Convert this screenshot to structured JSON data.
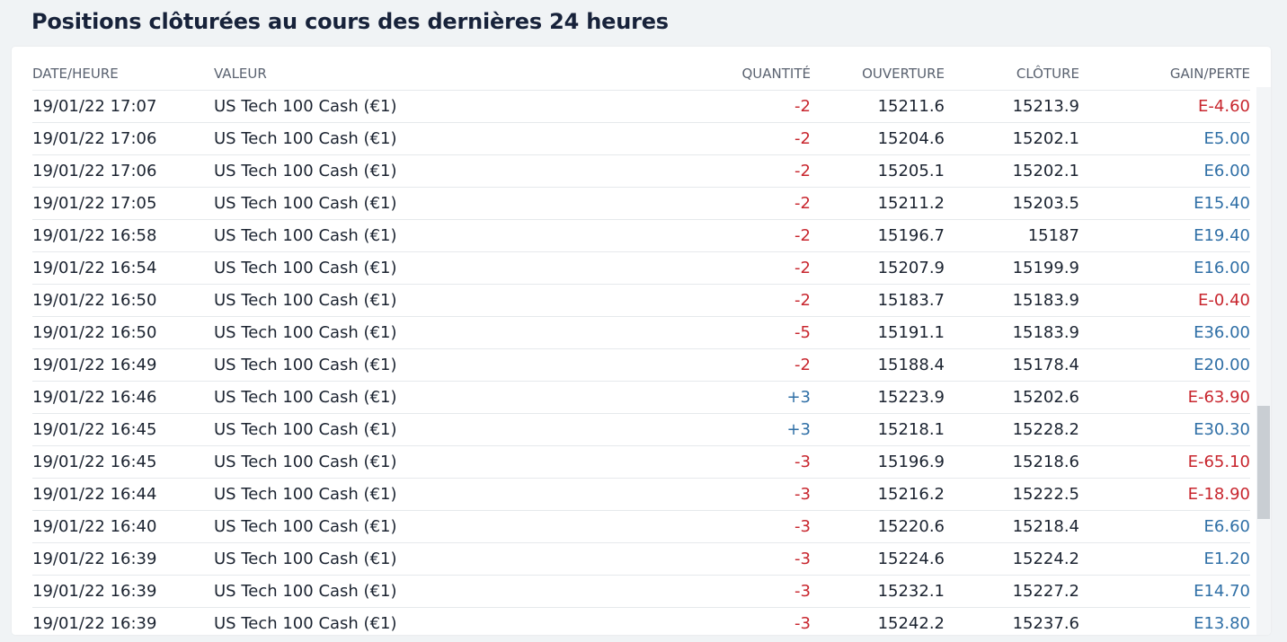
{
  "title": "Positions clôturées au cours des dernières 24 heures",
  "columns": {
    "date": "DATE/HEURE",
    "value": "VALEUR",
    "quantity": "QUANTITÉ",
    "open": "OUVERTURE",
    "close": "CLÔTURE",
    "pl": "GAIN/PERTE"
  },
  "colors": {
    "negative": "#c8262e",
    "positive": "#2f6fa6"
  },
  "rows": [
    {
      "date": "19/01/22 17:07",
      "value": "US Tech 100 Cash (€1)",
      "qty": "-2",
      "open": "15211.6",
      "close": "15213.9",
      "pl": "E-4.60"
    },
    {
      "date": "19/01/22 17:06",
      "value": "US Tech 100 Cash (€1)",
      "qty": "-2",
      "open": "15204.6",
      "close": "15202.1",
      "pl": "E5.00"
    },
    {
      "date": "19/01/22 17:06",
      "value": "US Tech 100 Cash (€1)",
      "qty": "-2",
      "open": "15205.1",
      "close": "15202.1",
      "pl": "E6.00"
    },
    {
      "date": "19/01/22 17:05",
      "value": "US Tech 100 Cash (€1)",
      "qty": "-2",
      "open": "15211.2",
      "close": "15203.5",
      "pl": "E15.40"
    },
    {
      "date": "19/01/22 16:58",
      "value": "US Tech 100 Cash (€1)",
      "qty": "-2",
      "open": "15196.7",
      "close": "15187",
      "pl": "E19.40"
    },
    {
      "date": "19/01/22 16:54",
      "value": "US Tech 100 Cash (€1)",
      "qty": "-2",
      "open": "15207.9",
      "close": "15199.9",
      "pl": "E16.00"
    },
    {
      "date": "19/01/22 16:50",
      "value": "US Tech 100 Cash (€1)",
      "qty": "-2",
      "open": "15183.7",
      "close": "15183.9",
      "pl": "E-0.40"
    },
    {
      "date": "19/01/22 16:50",
      "value": "US Tech 100 Cash (€1)",
      "qty": "-5",
      "open": "15191.1",
      "close": "15183.9",
      "pl": "E36.00"
    },
    {
      "date": "19/01/22 16:49",
      "value": "US Tech 100 Cash (€1)",
      "qty": "-2",
      "open": "15188.4",
      "close": "15178.4",
      "pl": "E20.00"
    },
    {
      "date": "19/01/22 16:46",
      "value": "US Tech 100 Cash (€1)",
      "qty": "+3",
      "open": "15223.9",
      "close": "15202.6",
      "pl": "E-63.90"
    },
    {
      "date": "19/01/22 16:45",
      "value": "US Tech 100 Cash (€1)",
      "qty": "+3",
      "open": "15218.1",
      "close": "15228.2",
      "pl": "E30.30"
    },
    {
      "date": "19/01/22 16:45",
      "value": "US Tech 100 Cash (€1)",
      "qty": "-3",
      "open": "15196.9",
      "close": "15218.6",
      "pl": "E-65.10"
    },
    {
      "date": "19/01/22 16:44",
      "value": "US Tech 100 Cash (€1)",
      "qty": "-3",
      "open": "15216.2",
      "close": "15222.5",
      "pl": "E-18.90"
    },
    {
      "date": "19/01/22 16:40",
      "value": "US Tech 100 Cash (€1)",
      "qty": "-3",
      "open": "15220.6",
      "close": "15218.4",
      "pl": "E6.60"
    },
    {
      "date": "19/01/22 16:39",
      "value": "US Tech 100 Cash (€1)",
      "qty": "-3",
      "open": "15224.6",
      "close": "15224.2",
      "pl": "E1.20"
    },
    {
      "date": "19/01/22 16:39",
      "value": "US Tech 100 Cash (€1)",
      "qty": "-3",
      "open": "15232.1",
      "close": "15227.2",
      "pl": "E14.70"
    },
    {
      "date": "19/01/22 16:39",
      "value": "US Tech 100 Cash (€1)",
      "qty": "-3",
      "open": "15242.2",
      "close": "15237.6",
      "pl": "E13.80"
    }
  ]
}
